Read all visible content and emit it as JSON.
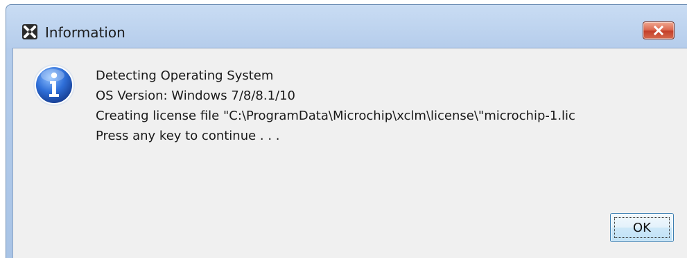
{
  "dialog": {
    "title": "Information",
    "app_icon": "xc-logo-icon",
    "close_icon": "close-icon",
    "message_icon": "info-icon",
    "messages": [
      "Detecting Operating System",
      "OS Version: Windows 7/8/8.1/10",
      "Creating license file \"C:\\ProgramData\\Microchip\\xclm\\license\\\"microchip-1.lic",
      "Press any key to continue . . ."
    ],
    "ok_label": "OK"
  },
  "colors": {
    "titlebar": "#b4cceb",
    "content_bg": "#f0f0f0",
    "close_button": "#c4402a",
    "info_blue": "#2a63c4"
  }
}
